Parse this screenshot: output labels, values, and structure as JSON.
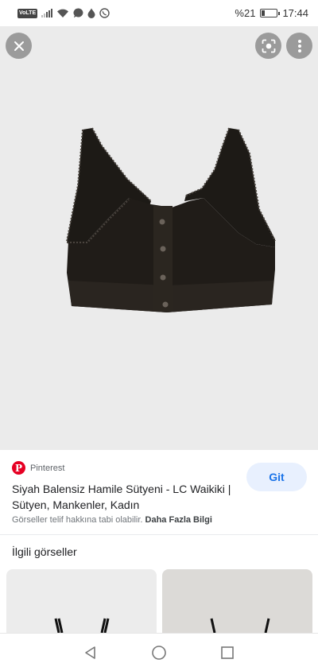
{
  "status_bar": {
    "volte": "VoLTE",
    "battery_percent": "%21",
    "battery_level": 0.21,
    "time": "17:44",
    "icons": [
      "signal-icon",
      "wifi-icon",
      "messenger-icon",
      "drop-icon",
      "whatsapp-icon"
    ]
  },
  "viewer": {
    "image_subject": "black bra with front buttons and lace trim",
    "buttons": [
      "close-icon",
      "lens-icon",
      "more-vert-icon"
    ]
  },
  "result": {
    "source": "Pinterest",
    "title": "Siyah Balensiz Hamile Sütyeni - LC Waikiki | Sütyen, Mankenler, Kadın",
    "visit_label": "Git",
    "copyright_text": "Görseller telif hakkına tabi olabilir.",
    "learn_more": "Daha Fazla Bilgi"
  },
  "related": {
    "title": "İlgili görseller"
  },
  "colors": {
    "pinterest_red": "#e60023",
    "accent_blue": "#1a73e8",
    "button_bg": "#e8f0fe"
  }
}
